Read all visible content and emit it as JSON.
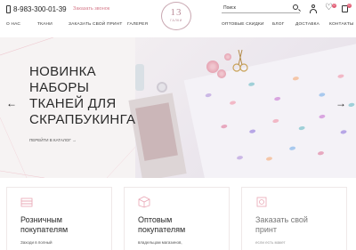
{
  "header": {
    "phone": "8-983-300-01-39",
    "callback_link": "Заказать звонок",
    "logo": {
      "number": "13",
      "subtitle": "ГАЛКИ"
    },
    "search": {
      "placeholder": "Поиск",
      "value": ""
    },
    "wishlist_count": "0",
    "cart_count": "0",
    "icons": [
      "phone-icon",
      "search-icon",
      "user-icon",
      "heart-icon",
      "bag-icon"
    ]
  },
  "nav": {
    "items": [
      "О НАС",
      "ТКАНИ",
      "ЗАКАЗАТЬ СВОЙ ПРИНТ",
      "ГАЛЕРЕЯ",
      "ОПТОВЫЕ СКИДКИ",
      "БЛОГ",
      "ДОСТАВКА",
      "КОНТАКТЫ"
    ]
  },
  "hero": {
    "title_lines": [
      "НОВИНКА",
      "НАБОРЫ",
      "ТКАНЕЙ ДЛЯ",
      "СКРАПБУКИНГА"
    ],
    "link": "ПЕРЕЙТИ В КАТАЛОГ →",
    "prev_arrow": "←",
    "next_arrow": "→"
  },
  "cards": [
    {
      "title_lines": [
        "Розничным",
        "покупателям"
      ],
      "text": "Заходи в полный"
    },
    {
      "title_lines": [
        "Оптовым",
        "покупателям"
      ],
      "text": "владельцам магазинов,"
    },
    {
      "title_lines": [
        "Заказать свой",
        "принт"
      ],
      "text": "если есть макет"
    }
  ],
  "colors": {
    "accent": "#d57a8a",
    "badge": "#e05a72",
    "text": "#2b2b2b"
  }
}
